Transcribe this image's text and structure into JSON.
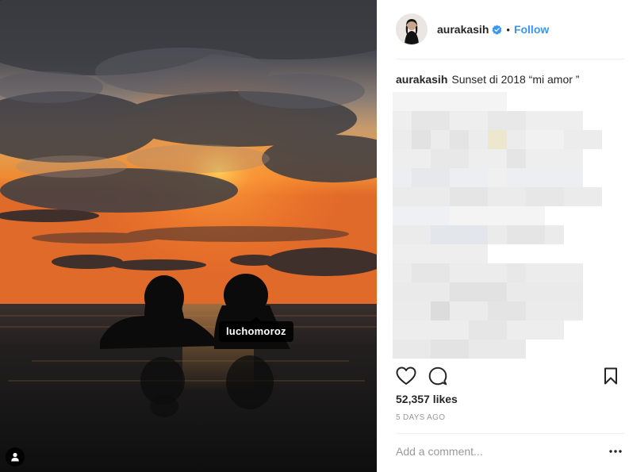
{
  "post": {
    "username": "aurakasih",
    "follow_label": "Follow",
    "separator": "•",
    "caption_text": "Sunset di 2018 “mi amor ”",
    "likes": "52,357 likes",
    "time_ago": "5 DAYS AGO",
    "comment_placeholder": "Add a comment..."
  },
  "photo": {
    "tagged_user": "luchomoroz"
  },
  "icons": {
    "verified": "verified-badge-icon",
    "like": "heart-icon",
    "comment": "speech-bubble-icon",
    "save": "bookmark-icon",
    "more": "ellipsis-icon",
    "tagged_users": "user-tag-icon"
  },
  "colors": {
    "accent": "#3897f0",
    "text": "#262626",
    "muted": "#999999"
  }
}
